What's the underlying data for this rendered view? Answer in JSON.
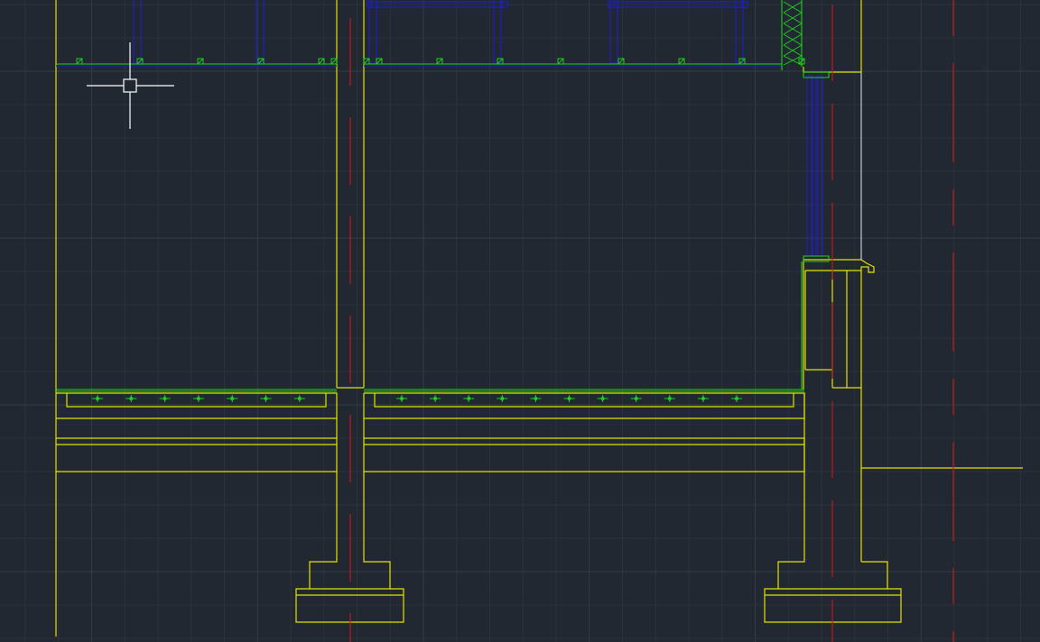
{
  "colors": {
    "background": "#222831",
    "grid_minor": "#2b323c",
    "grid_major": "#333b46",
    "yellow": "#e2e200",
    "blue": "#1e1ebe",
    "green": "#1ed01e",
    "red": "#c01818",
    "white": "#dcdcdc",
    "gray": "#9aa0a6"
  },
  "icons": {
    "cursor": "crosshair-pickbox-icon"
  }
}
